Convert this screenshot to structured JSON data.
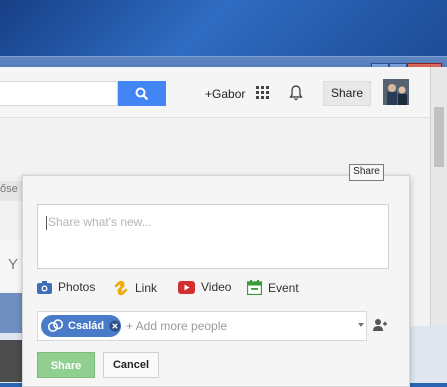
{
  "window": {
    "minimize": "–",
    "maximize": "□",
    "close": "x"
  },
  "header": {
    "profile_link": "+Gabor",
    "share_button": "Share",
    "share_tooltip": "Share"
  },
  "background": {
    "fragment_1": "őse",
    "fragment_2": "Y"
  },
  "share_box": {
    "placeholder": "Share what's new...",
    "attachments": [
      {
        "label": "Photos",
        "icon": "camera-icon",
        "color": "#3f6fb6"
      },
      {
        "label": "Link",
        "icon": "link-icon",
        "color": "#f2a900"
      },
      {
        "label": "Video",
        "icon": "youtube-icon",
        "color": "#d32f2f"
      },
      {
        "label": "Event",
        "icon": "calendar-icon",
        "color": "#3a9b3a"
      }
    ],
    "audience_chip": "Család",
    "add_people_placeholder": "+ Add more people",
    "share_label": "Share",
    "cancel_label": "Cancel"
  },
  "colors": {
    "accent_blue": "#4285f4",
    "share_green": "#8fcf8f",
    "chip_blue": "#4a7bc9"
  }
}
